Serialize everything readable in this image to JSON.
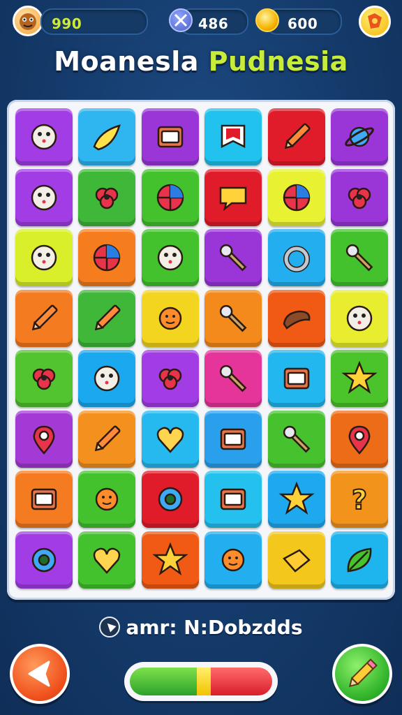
{
  "hud": {
    "level": "990",
    "attack": "486",
    "coins": "600"
  },
  "title": {
    "part1": "Moanesla ",
    "part2": "Pudnesia"
  },
  "status_text": "amr: N:Dobzdds",
  "progress": {
    "green": 0.47,
    "yellow": 0.1,
    "red": 0.43
  },
  "tile_icons": [
    [
      "cookie-icon",
      "rocket-icon",
      "briefcase-icon",
      "banner-icon",
      "feather-icon",
      "planet-icon"
    ],
    [
      "cookie-face-icon",
      "dragon-icon",
      "eyeball-icon",
      "speech-bubble-icon",
      "beach-ball-icon",
      "virus-icon"
    ],
    [
      "cookie-monster-icon",
      "beach-ball-icon",
      "cookie-pop-icon",
      "wand-icon",
      "ring-icon",
      "lollipop-icon"
    ],
    [
      "pencil-icon",
      "feather-icon",
      "sun-face-icon",
      "bone-icon",
      "sausage-icon",
      "robot-face-icon"
    ],
    [
      "flower-icon",
      "goblet-face-icon",
      "glove-icon",
      "key-icon",
      "box-face-icon",
      "star-icon"
    ],
    [
      "map-pin-icon",
      "crayon-icon",
      "window-heart-icon",
      "battery-icon",
      "wrench-icon",
      "location-pin-icon"
    ],
    [
      "ticket-icon",
      "sun-face-icon",
      "gear-icon",
      "book-icon",
      "star-badge-icon",
      "question-icon"
    ],
    [
      "gear-face-icon",
      "heart-balloon-icon",
      "star-icon",
      "spiky-sun-icon",
      "cheese-icon",
      "leaf-icon"
    ]
  ],
  "tile_colors": [
    [
      "#a23ce4",
      "#2fb5f0",
      "#9a36d8",
      "#22c2ee",
      "#e01c2a",
      "#9a36d8"
    ],
    [
      "#a23ce4",
      "#3fb83a",
      "#43c22e",
      "#e01c2a",
      "#e8f233",
      "#9a36d8"
    ],
    [
      "#d8ef2a",
      "#f57d1e",
      "#43c22e",
      "#9a36d8",
      "#22aeef",
      "#43c22e"
    ],
    [
      "#f47b1f",
      "#3fb83a",
      "#f3d51f",
      "#f58a1c",
      "#f05a14",
      "#e8ee2f"
    ],
    [
      "#52c430",
      "#1aa9ef",
      "#a23ce4",
      "#e6359a",
      "#22b8ef",
      "#4bc42c"
    ],
    [
      "#a33ad6",
      "#f4901d",
      "#25b9ef",
      "#2aa0ec",
      "#46c22f",
      "#ec6c18"
    ],
    [
      "#f47b1f",
      "#43c22e",
      "#e01c2a",
      "#24c1ef",
      "#1ea9ef",
      "#f2941c"
    ],
    [
      "#a23ce4",
      "#43c22e",
      "#f05a14",
      "#22aeef",
      "#f3c71c",
      "#1eb4ee"
    ]
  ]
}
